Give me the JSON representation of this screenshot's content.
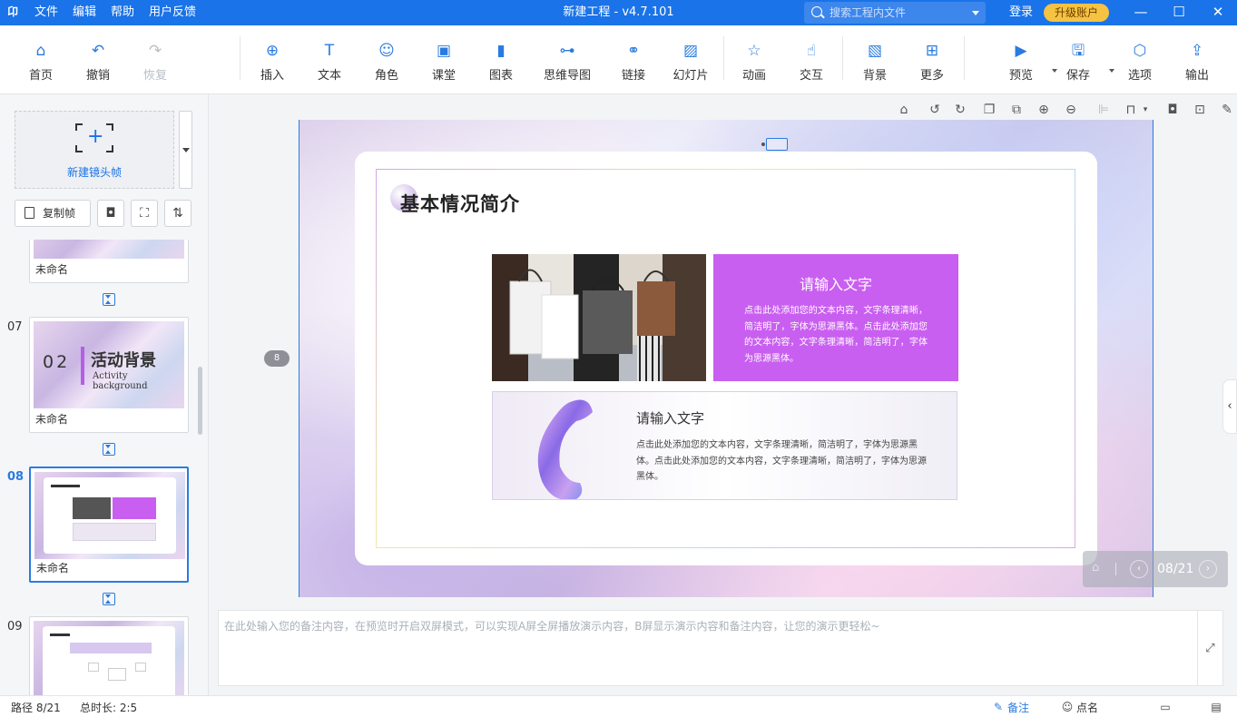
{
  "titlebar": {
    "logo": "卬",
    "menu": [
      "文件",
      "编辑",
      "帮助",
      "用户反馈"
    ],
    "title": "新建工程 - v4.7.101",
    "search_placeholder": "搜索工程内文件",
    "login": "登录",
    "upgrade": "升级账户"
  },
  "toolbar": {
    "home": "首页",
    "undo": "撤销",
    "redo": "恢复",
    "insert": "插入",
    "text": "文本",
    "role": "角色",
    "class": "课堂",
    "chart": "图表",
    "mindmap": "思维导图",
    "link": "链接",
    "slides": "幻灯片",
    "animation": "动画",
    "interact": "交互",
    "background": "背景",
    "more": "更多",
    "preview": "预览",
    "save": "保存",
    "options": "选项",
    "export": "输出"
  },
  "leftpanel": {
    "new_frame": "新建镜头帧",
    "copy_frame": "复制帧",
    "thumbs": [
      {
        "num": "",
        "name": "未命名"
      },
      {
        "num": "07",
        "name": "未命名",
        "title_num": "02",
        "title": "活动背景",
        "subtitle": "Activity background"
      },
      {
        "num": "08",
        "name": "未命名"
      },
      {
        "num": "09",
        "name": ""
      }
    ]
  },
  "slide": {
    "title": "基本情况简介",
    "box1_heading": "请输入文字",
    "box1_text": "点击此处添加您的文本内容，文字条理清晰，简洁明了，字体为思源黑体。点击此处添加您的文本内容，文字条理清晰，简洁明了，字体为思源黑体。",
    "box2_heading": "请输入文字",
    "box2_text": "点击此处添加您的文本内容，文字条理清晰，简洁明了，字体为思源黑体。点击此处添加您的文本内容，文字条理清晰，简洁明了，字体为思源黑体。",
    "side_index": "8",
    "pager": "08/21"
  },
  "notes": {
    "placeholder": "在此处输入您的备注内容，在预览时开启双屏模式，可以实现A屏全屏播放演示内容，B屏显示演示内容和备注内容，让您的演示更轻松~"
  },
  "statusbar": {
    "path": "路径 8/21",
    "duration": "总时长: 2:5",
    "notes": "备注",
    "rollcall": "点名"
  },
  "colors": {
    "accent": "#1a73e8",
    "purple": "#c95ff0",
    "upgrade": "#f5c242"
  }
}
